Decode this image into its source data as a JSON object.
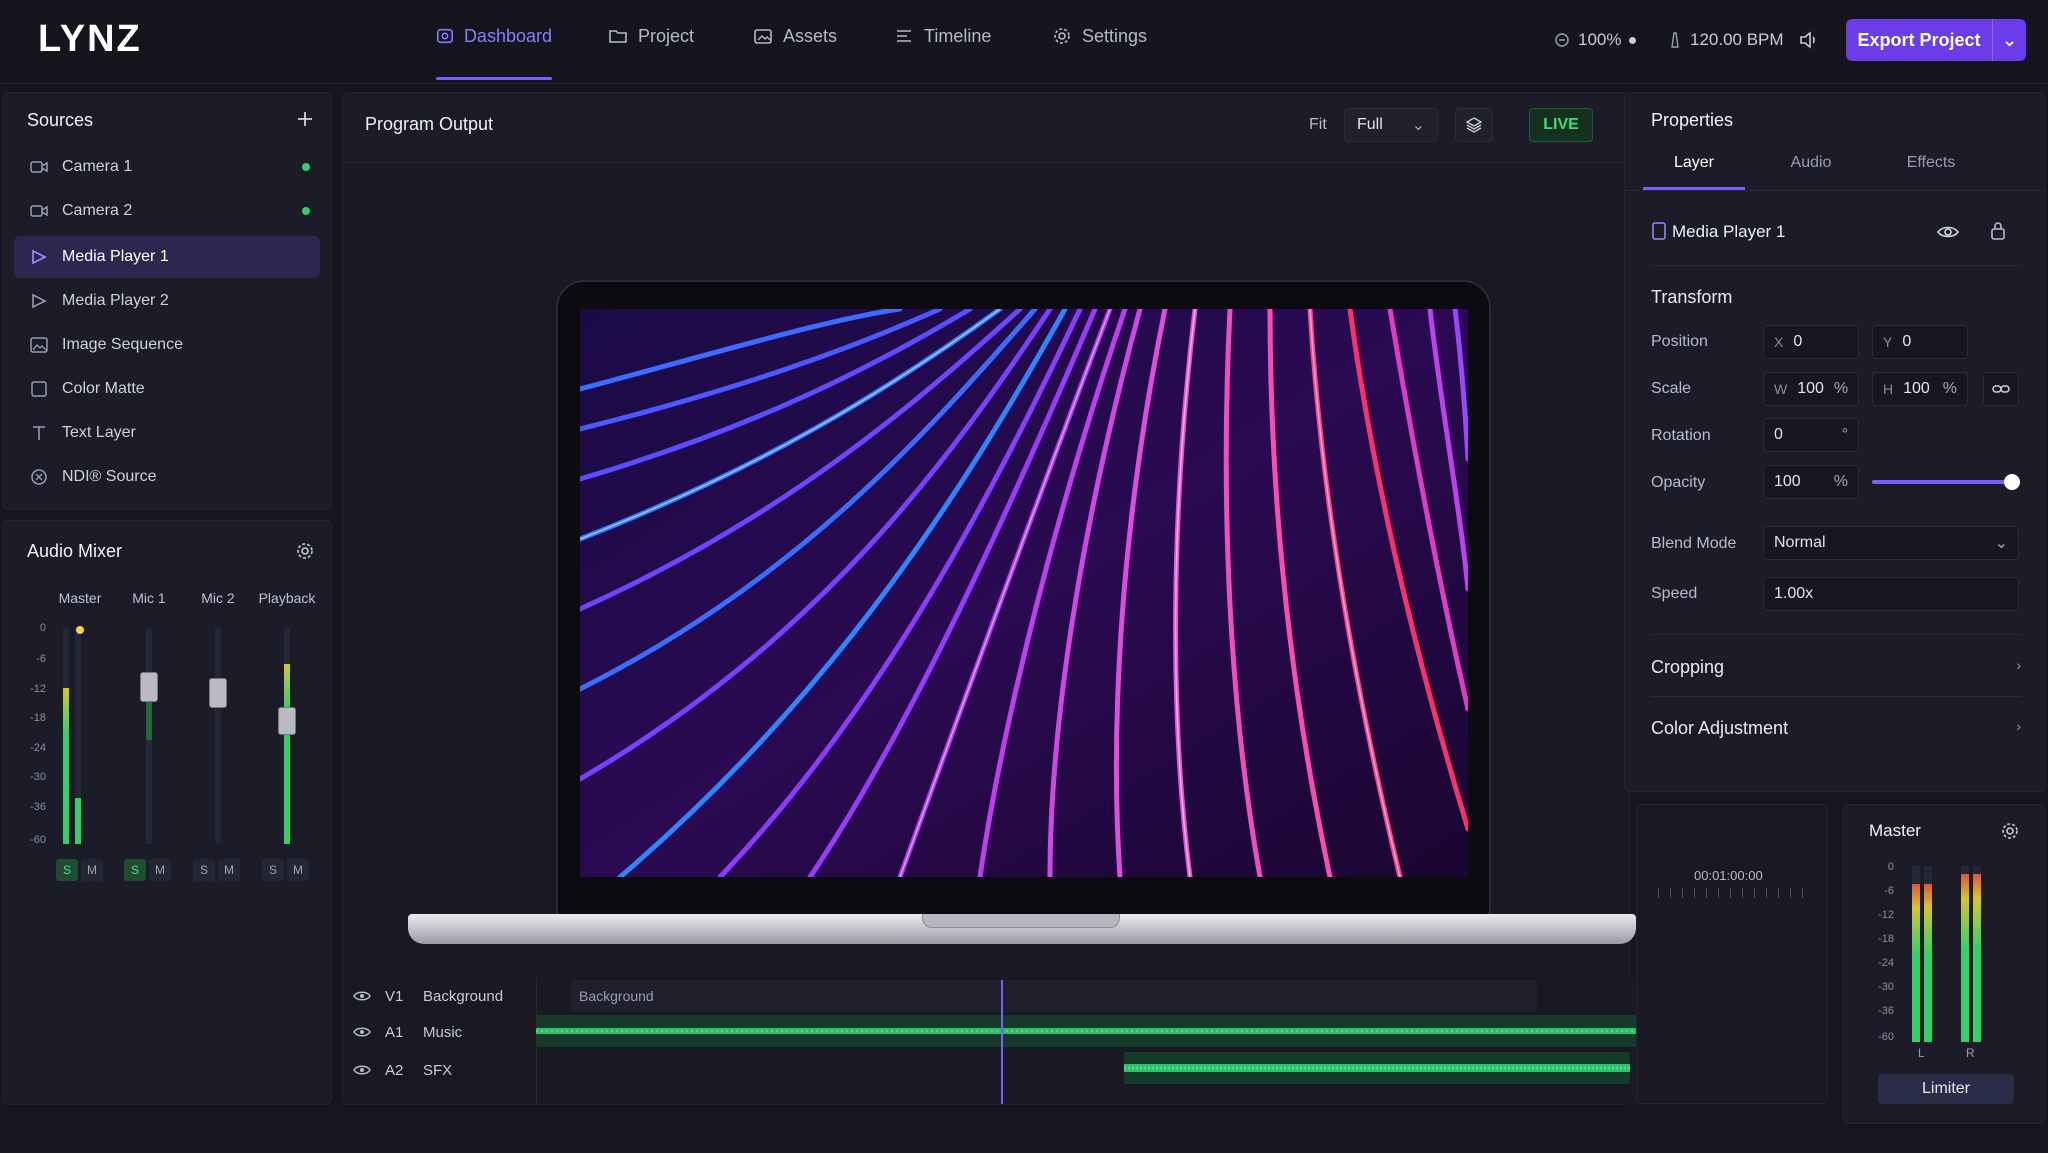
{
  "app": {
    "logo": "LYNZ"
  },
  "nav": {
    "tabs": [
      {
        "label": "Dashboard",
        "icon": "dashboard-icon",
        "active": true
      },
      {
        "label": "Project",
        "icon": "folder-icon",
        "active": false
      },
      {
        "label": "Assets",
        "icon": "assets-icon",
        "active": false
      },
      {
        "label": "Timeline",
        "icon": "timeline-icon",
        "active": false
      },
      {
        "label": "Settings",
        "icon": "gear-icon",
        "active": false
      }
    ]
  },
  "status": {
    "zoom": "100%",
    "bpm": "120.00 BPM"
  },
  "export": {
    "label": "Export Project"
  },
  "sources": {
    "title": "Sources",
    "items": [
      {
        "label": "Camera 1",
        "icon": "camera-icon",
        "live": true
      },
      {
        "label": "Camera 2",
        "icon": "camera-icon",
        "live": true
      },
      {
        "label": "Media Player 1",
        "icon": "play-icon",
        "selected": true
      },
      {
        "label": "Media Player 2",
        "icon": "play-icon"
      },
      {
        "label": "Image Sequence",
        "icon": "image-icon"
      },
      {
        "label": "Color Matte",
        "icon": "square-icon"
      },
      {
        "label": "Text Layer",
        "icon": "text-icon"
      },
      {
        "label": "NDI® Source",
        "icon": "ndi-icon"
      }
    ]
  },
  "mixer": {
    "title": "Audio Mixer",
    "channels": [
      {
        "name": "Master",
        "level": 0.74,
        "solo": true
      },
      {
        "name": "Mic 1",
        "level": 0.0,
        "solo": true
      },
      {
        "name": "Mic 2",
        "level": 0.0,
        "solo": false
      },
      {
        "name": "Playback",
        "level": 0.83,
        "solo": false
      }
    ],
    "db_ticks": [
      "0",
      "-6",
      "-12",
      "-18",
      "-24",
      "-30",
      "-36",
      "-60"
    ],
    "solo_label": "S",
    "mute_label": "M"
  },
  "program": {
    "title": "Program Output",
    "fit_label": "Fit",
    "fit_value": "Full",
    "live_label": "LIVE"
  },
  "timeline": {
    "timecode": "00:01:00:00",
    "tracks": [
      {
        "id": "V1",
        "name": "Background",
        "clip": "Background"
      },
      {
        "id": "A1",
        "name": "Music"
      },
      {
        "id": "A2",
        "name": "SFX"
      }
    ]
  },
  "properties": {
    "title": "Properties",
    "tabs": [
      "Layer",
      "Audio",
      "Effects"
    ],
    "layer_name": "Media Player 1",
    "transform": {
      "title": "Transform",
      "position_label": "Position",
      "x": "0",
      "y": "0",
      "scale_label": "Scale",
      "w": "100",
      "h": "100",
      "rotation_label": "Rotation",
      "rotation": "0",
      "deg": "°",
      "opacity_label": "Opacity",
      "opacity": "100",
      "opacity_fraction": 1.0,
      "pct": "%",
      "blend_label": "Blend Mode",
      "blend": "Normal",
      "speed_label": "Speed",
      "speed": "1.00x"
    },
    "cropping": "Cropping",
    "color_adjustment": "Color Adjustment"
  },
  "master": {
    "title": "Master",
    "ticks": [
      "0",
      "-6",
      "-12",
      "-18",
      "-24",
      "-30",
      "-36",
      "-60"
    ],
    "left": "L",
    "right": "R",
    "limiter": "Limiter"
  }
}
